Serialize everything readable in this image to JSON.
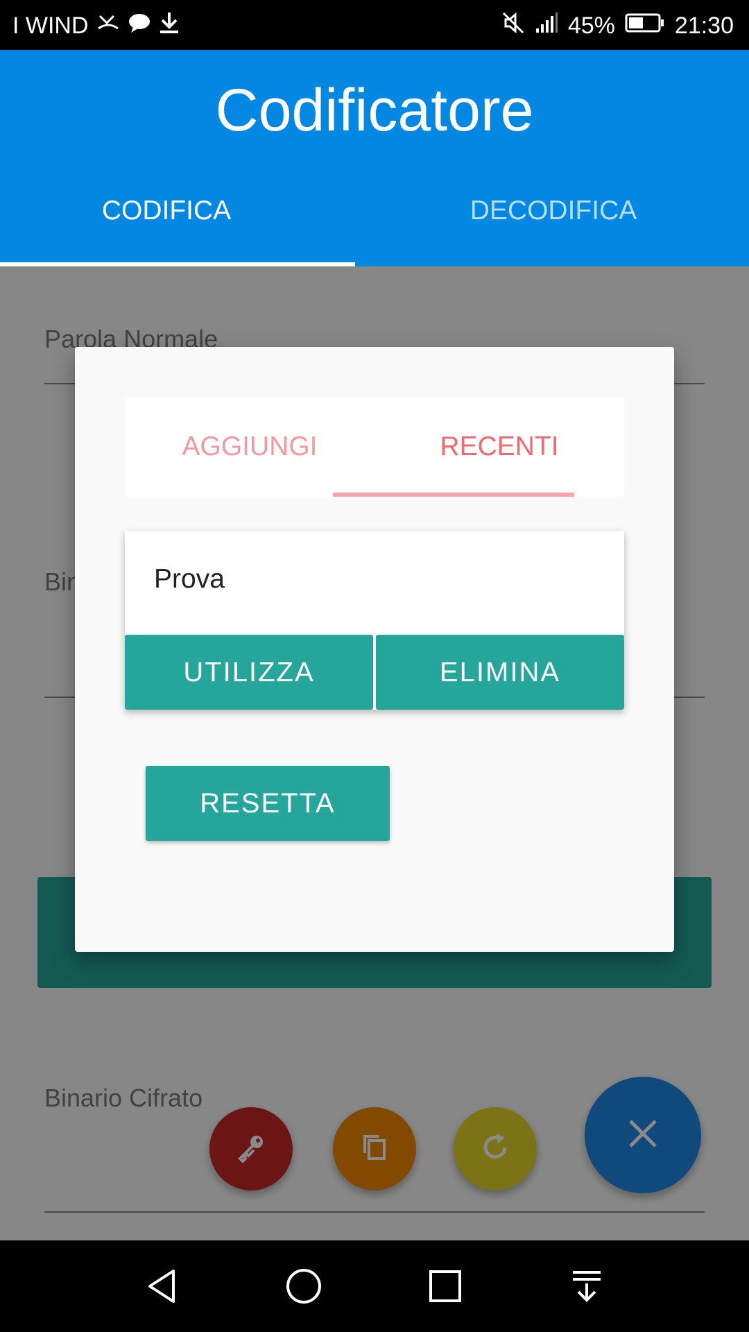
{
  "status_bar": {
    "carrier": "I WIND",
    "battery": "45%",
    "time": "21:30"
  },
  "app": {
    "title": "Codificatore",
    "tabs": [
      {
        "label": "CODIFICA",
        "selected": true
      },
      {
        "label": "DECODIFICA",
        "selected": false
      }
    ]
  },
  "form": {
    "field1_label": "Parola Normale",
    "field2_label": "Bin",
    "field3_label": "Binario Cifrato"
  },
  "dialog": {
    "tabs": [
      {
        "label": "AGGIUNGI",
        "selected": false
      },
      {
        "label": "RECENTI",
        "selected": true
      }
    ],
    "recent_item": "Prova",
    "use_button": "UTILIZZA",
    "delete_button": "ELIMINA",
    "reset_button": "RESETTA"
  },
  "fabs": [
    {
      "icon": "key-icon",
      "color": "#c62828"
    },
    {
      "icon": "copy-icon",
      "color": "#ef8a00"
    },
    {
      "icon": "refresh-icon",
      "color": "#e5d42a"
    },
    {
      "icon": "close-icon",
      "color": "#1e88e5"
    }
  ],
  "colors": {
    "primary": "#0288e3",
    "accent_teal": "#26a69a",
    "tab_pink": "#ef6a72"
  }
}
